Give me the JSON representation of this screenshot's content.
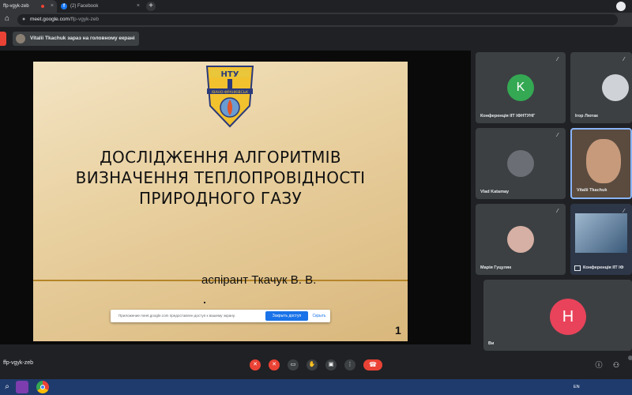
{
  "browser": {
    "tab_active_title": "ffp-vgyk-zeb",
    "tab_inactive_title": "(2) Facebook",
    "url_host": "meet.google.com",
    "url_path": "/ffp-vgyk-zeb"
  },
  "meet": {
    "presenter_banner": "Vitalii Tkachuk зараз на головному екрані",
    "meeting_code": "ffp-vgyk-zeb"
  },
  "slide": {
    "title_lines": [
      "Дослідження алгоритмів",
      "визначення теплопровідності",
      "природного газу"
    ],
    "author": "аспірант Ткачук В. В.",
    "page_number": "1",
    "logo_letters": "НТУ",
    "logo_ribbon": "ІВАНО-ФРАНКІВСЬК"
  },
  "share_notice": {
    "text": "Приложение meet.google.com предоставлен доступ к вашему экрану.",
    "stop_label": "Закрыть доступ",
    "hide_label": "Скрыть"
  },
  "participants": [
    {
      "name": "Конференція ІІТ ІФНТУНГ",
      "avatar_letter": "K",
      "avatar_color": "#34a853"
    },
    {
      "name": "Ігор Лютак",
      "avatar_letter": "",
      "avatar_color": "#9aa0a6"
    },
    {
      "name": "Vlad Katamay",
      "avatar_letter": "",
      "avatar_color": "#5f6368"
    },
    {
      "name": "Vitalii Tkachuk",
      "avatar_letter": "",
      "avatar_color": "#5a4b3e"
    },
    {
      "name": "Марія Гуцуляк",
      "avatar_letter": "",
      "avatar_color": "#b07a6a"
    },
    {
      "name": "Конференція ІІТ ІФ",
      "avatar_letter": "",
      "avatar_color": "#2d3748"
    },
    {
      "name": "Ви",
      "avatar_letter": "H",
      "avatar_color": "#e8435a"
    }
  ],
  "tray": {
    "lang": "EN"
  }
}
